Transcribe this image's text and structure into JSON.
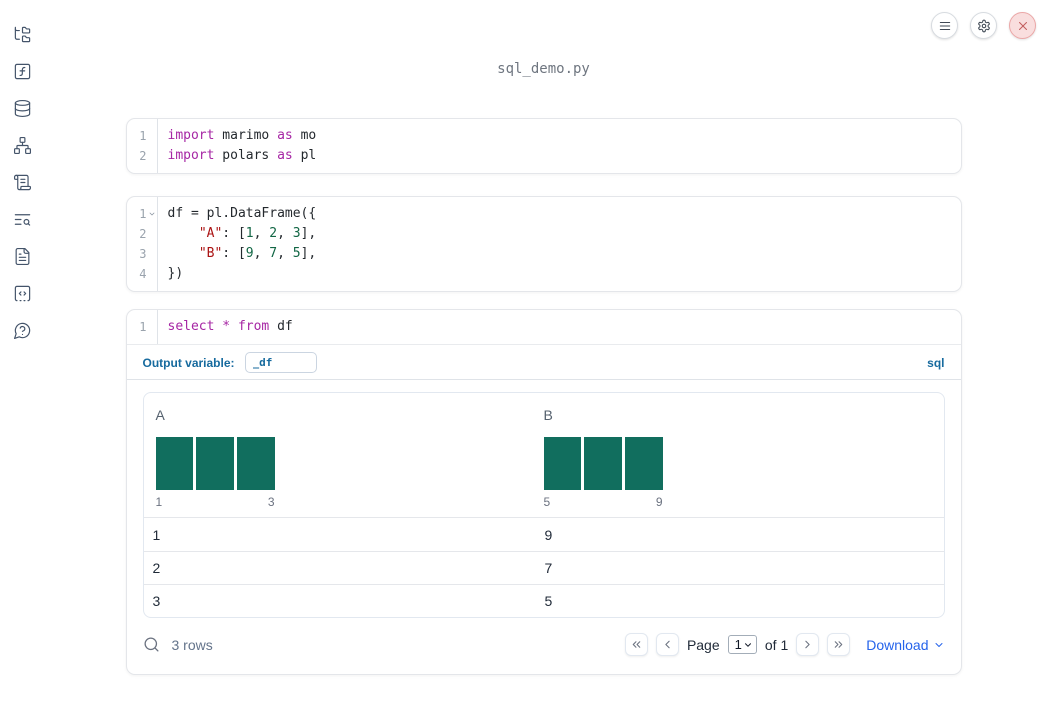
{
  "app": {
    "title": "sql_demo.py"
  },
  "header": {
    "buttons": [
      {
        "icon": "menu-icon"
      },
      {
        "icon": "gear-icon"
      },
      {
        "icon": "shutdown-icon"
      }
    ]
  },
  "sidebar": {
    "icons": [
      "file-tree-icon",
      "function-square-icon",
      "database-icon",
      "dependency-graph-icon",
      "scroll-icon",
      "search-list-icon",
      "document-icon",
      "snippets-icon",
      "help-icon"
    ]
  },
  "cells": [
    {
      "kind": "python",
      "lines": [
        {
          "num": "1",
          "tokens": [
            [
              "kw",
              "import"
            ],
            [
              "pl",
              " marimo "
            ],
            [
              "kw",
              "as"
            ],
            [
              "pl",
              " mo"
            ]
          ]
        },
        {
          "num": "2",
          "tokens": [
            [
              "kw",
              "import"
            ],
            [
              "pl",
              " polars "
            ],
            [
              "kw",
              "as"
            ],
            [
              "pl",
              " pl"
            ]
          ]
        }
      ]
    },
    {
      "kind": "python",
      "lines": [
        {
          "num": "1",
          "fold": true,
          "tokens": [
            [
              "pl",
              "df = pl.DataFrame({"
            ]
          ]
        },
        {
          "num": "2",
          "tokens": [
            [
              "pl",
              "    "
            ],
            [
              "str",
              "\"A\""
            ],
            [
              "pl",
              ": ["
            ],
            [
              "num",
              "1"
            ],
            [
              "pl",
              ", "
            ],
            [
              "num",
              "2"
            ],
            [
              "pl",
              ", "
            ],
            [
              "num",
              "3"
            ],
            [
              "pl",
              "],"
            ]
          ]
        },
        {
          "num": "3",
          "tokens": [
            [
              "pl",
              "    "
            ],
            [
              "str",
              "\"B\""
            ],
            [
              "pl",
              ": ["
            ],
            [
              "num",
              "9"
            ],
            [
              "pl",
              ", "
            ],
            [
              "num",
              "7"
            ],
            [
              "pl",
              ", "
            ],
            [
              "num",
              "5"
            ],
            [
              "pl",
              "],"
            ]
          ]
        },
        {
          "num": "4",
          "tokens": [
            [
              "pl",
              "})"
            ]
          ]
        }
      ]
    },
    {
      "kind": "sql",
      "lines": [
        {
          "num": "1",
          "tokens": [
            [
              "kw",
              "select"
            ],
            [
              "pl",
              " "
            ],
            [
              "kw",
              "*"
            ],
            [
              "pl",
              " "
            ],
            [
              "kw",
              "from"
            ],
            [
              "pl",
              " df"
            ]
          ]
        }
      ]
    }
  ],
  "sql_cell": {
    "output_variable_label": "Output variable:",
    "output_variable_value": "_df",
    "language": "sql"
  },
  "table": {
    "columns": [
      {
        "name": "A",
        "histogram": {
          "type": "bar",
          "values": [
            1,
            1,
            1
          ],
          "min_label": "1",
          "max_label": "3"
        }
      },
      {
        "name": "B",
        "histogram": {
          "type": "bar",
          "values": [
            1,
            1,
            1
          ],
          "min_label": "5",
          "max_label": "9"
        }
      }
    ],
    "rows": [
      [
        "1",
        "9"
      ],
      [
        "2",
        "7"
      ],
      [
        "3",
        "5"
      ]
    ],
    "row_count_label": "3 rows",
    "pagination": {
      "page_label": "Page",
      "page_value": "1",
      "of_label": "of 1"
    },
    "download_label": "Download"
  },
  "colors": {
    "keyword": "#a626a4",
    "string": "#aa1111",
    "number": "#116644",
    "accent_blue": "#166a9e",
    "link_blue": "#2563eb",
    "hist_bar": "#116e5e",
    "danger_red": "#c25e5e"
  }
}
